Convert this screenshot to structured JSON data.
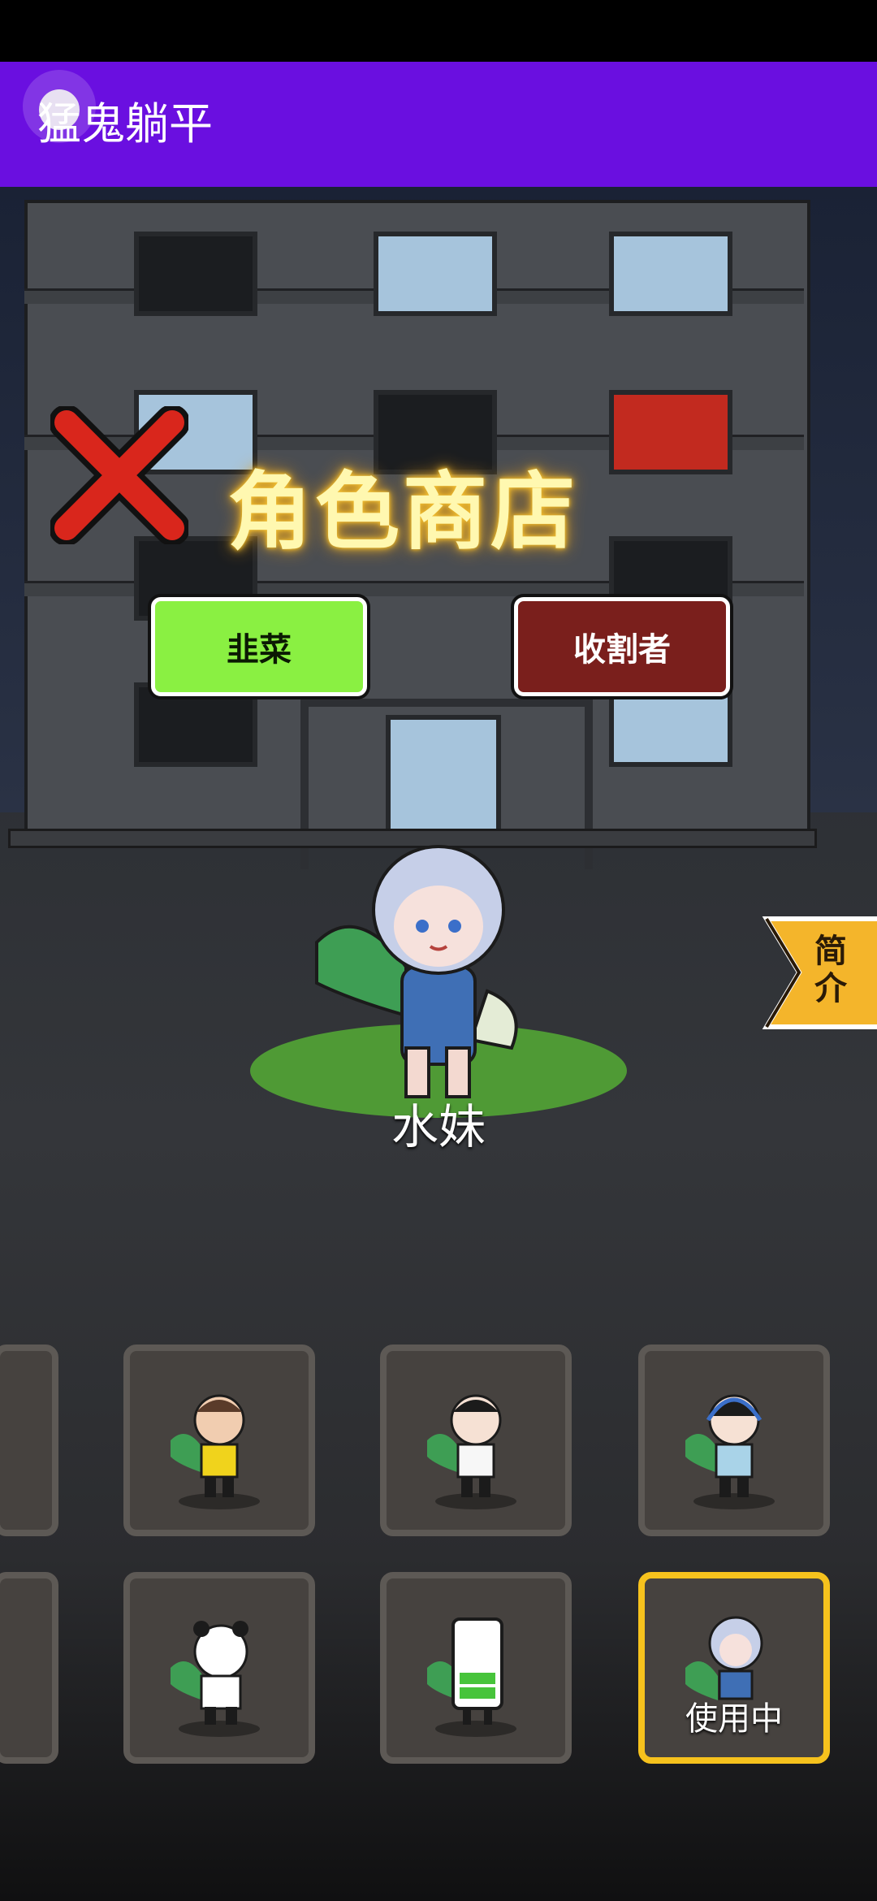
{
  "app_title": "猛鬼躺平",
  "shop_title": "角色商店",
  "tabs": [
    {
      "label": "韭菜"
    },
    {
      "label": "收割者"
    }
  ],
  "intro_label": "简介",
  "selected_character": {
    "name": "水妹"
  },
  "slots": [
    {
      "status": ""
    },
    {
      "status": ""
    },
    {
      "status": ""
    },
    {
      "status": ""
    },
    {
      "status": ""
    },
    {
      "status": ""
    },
    {
      "status": ""
    },
    {
      "status": "使用中"
    }
  ],
  "colors": {
    "app_bar": "#6a0fe0",
    "tab_green": "#8af042",
    "tab_red": "#7a1f1c",
    "selected_border": "#f6c21d"
  }
}
